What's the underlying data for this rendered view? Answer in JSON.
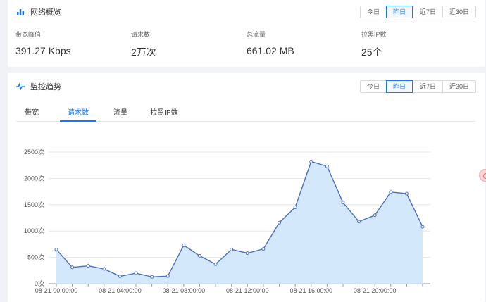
{
  "overview": {
    "title": "网络概览",
    "ranges": [
      "今日",
      "昨日",
      "近7日",
      "近30日"
    ],
    "active_range": 1,
    "stats": [
      {
        "label": "带宽峰值",
        "value": "391.27 Kbps"
      },
      {
        "label": "请求数",
        "value": "2万次"
      },
      {
        "label": "总流量",
        "value": "661.02 MB"
      },
      {
        "label": "拉黑IP数",
        "value": "25个"
      }
    ]
  },
  "monitor": {
    "title": "监控趋势",
    "ranges": [
      "今日",
      "昨日",
      "近7日",
      "近30日"
    ],
    "active_range": 1,
    "tabs": [
      "带宽",
      "请求数",
      "流量",
      "拉黑IP数"
    ],
    "active_tab": 1
  },
  "colors": {
    "accent": "#1677ff",
    "line": "#4a6fc1",
    "area": "#cfe5fb"
  },
  "chart_data": {
    "type": "area",
    "x": [
      "08-21 00:00:00",
      "08-21 01:00:00",
      "08-21 02:00:00",
      "08-21 03:00:00",
      "08-21 04:00:00",
      "08-21 05:00:00",
      "08-21 06:00:00",
      "08-21 07:00:00",
      "08-21 08:00:00",
      "08-21 09:00:00",
      "08-21 10:00:00",
      "08-21 11:00:00",
      "08-21 12:00:00",
      "08-21 13:00:00",
      "08-21 14:00:00",
      "08-21 15:00:00",
      "08-21 16:00:00",
      "08-21 17:00:00",
      "08-21 18:00:00",
      "08-21 19:00:00",
      "08-21 20:00:00",
      "08-21 21:00:00",
      "08-21 22:00:00",
      "08-21 23:00:00"
    ],
    "x_tick_labels": [
      "08-21 00:00:00",
      "08-21 04:00:00",
      "08-21 08:00:00",
      "08-21 12:00:00",
      "08-21 16:00:00",
      "08-21 20:00:00"
    ],
    "x_tick_every": 4,
    "series": [
      {
        "values": [
          650,
          310,
          340,
          280,
          140,
          200,
          130,
          145,
          730,
          530,
          370,
          650,
          580,
          660,
          1160,
          1450,
          2320,
          2230,
          1540,
          1180,
          1300,
          1740,
          1710,
          1080
        ]
      }
    ],
    "yticks": [
      0,
      500,
      1000,
      1500,
      2000,
      2500
    ],
    "ytick_labels": [
      "0次",
      "500次",
      "1000次",
      "1500次",
      "2000次",
      "2500次"
    ],
    "ylim": [
      0,
      2500
    ],
    "grid": true,
    "legend": "none"
  }
}
